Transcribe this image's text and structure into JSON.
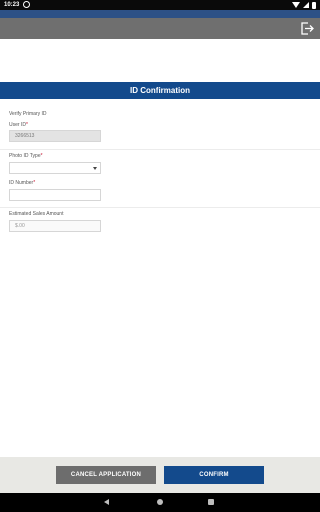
{
  "status_bar": {
    "time": "10:23"
  },
  "page": {
    "title": "ID Confirmation"
  },
  "form": {
    "section_title": "Verify Primary ID",
    "user_id": {
      "label": "User ID",
      "required_mark": "*",
      "value": "3266513"
    },
    "photo_id_type": {
      "label": "Photo ID Type",
      "required_mark": "*",
      "value": ""
    },
    "id_number": {
      "label": "ID Number",
      "required_mark": "*",
      "value": ""
    },
    "estimated_sales_amount": {
      "label": "Estimated Sales Amount",
      "value": "$.00"
    }
  },
  "actions": {
    "cancel_label": "CANCEL APPLICATION",
    "confirm_label": "CONFIRM"
  },
  "icons": {
    "logout": "logout-icon",
    "back": "back-icon",
    "home": "home-icon",
    "recents": "recents-icon"
  },
  "colors": {
    "header_blue": "#134a8c",
    "toolbar_gray": "#6f6f6f",
    "required_red": "#c8102e"
  }
}
